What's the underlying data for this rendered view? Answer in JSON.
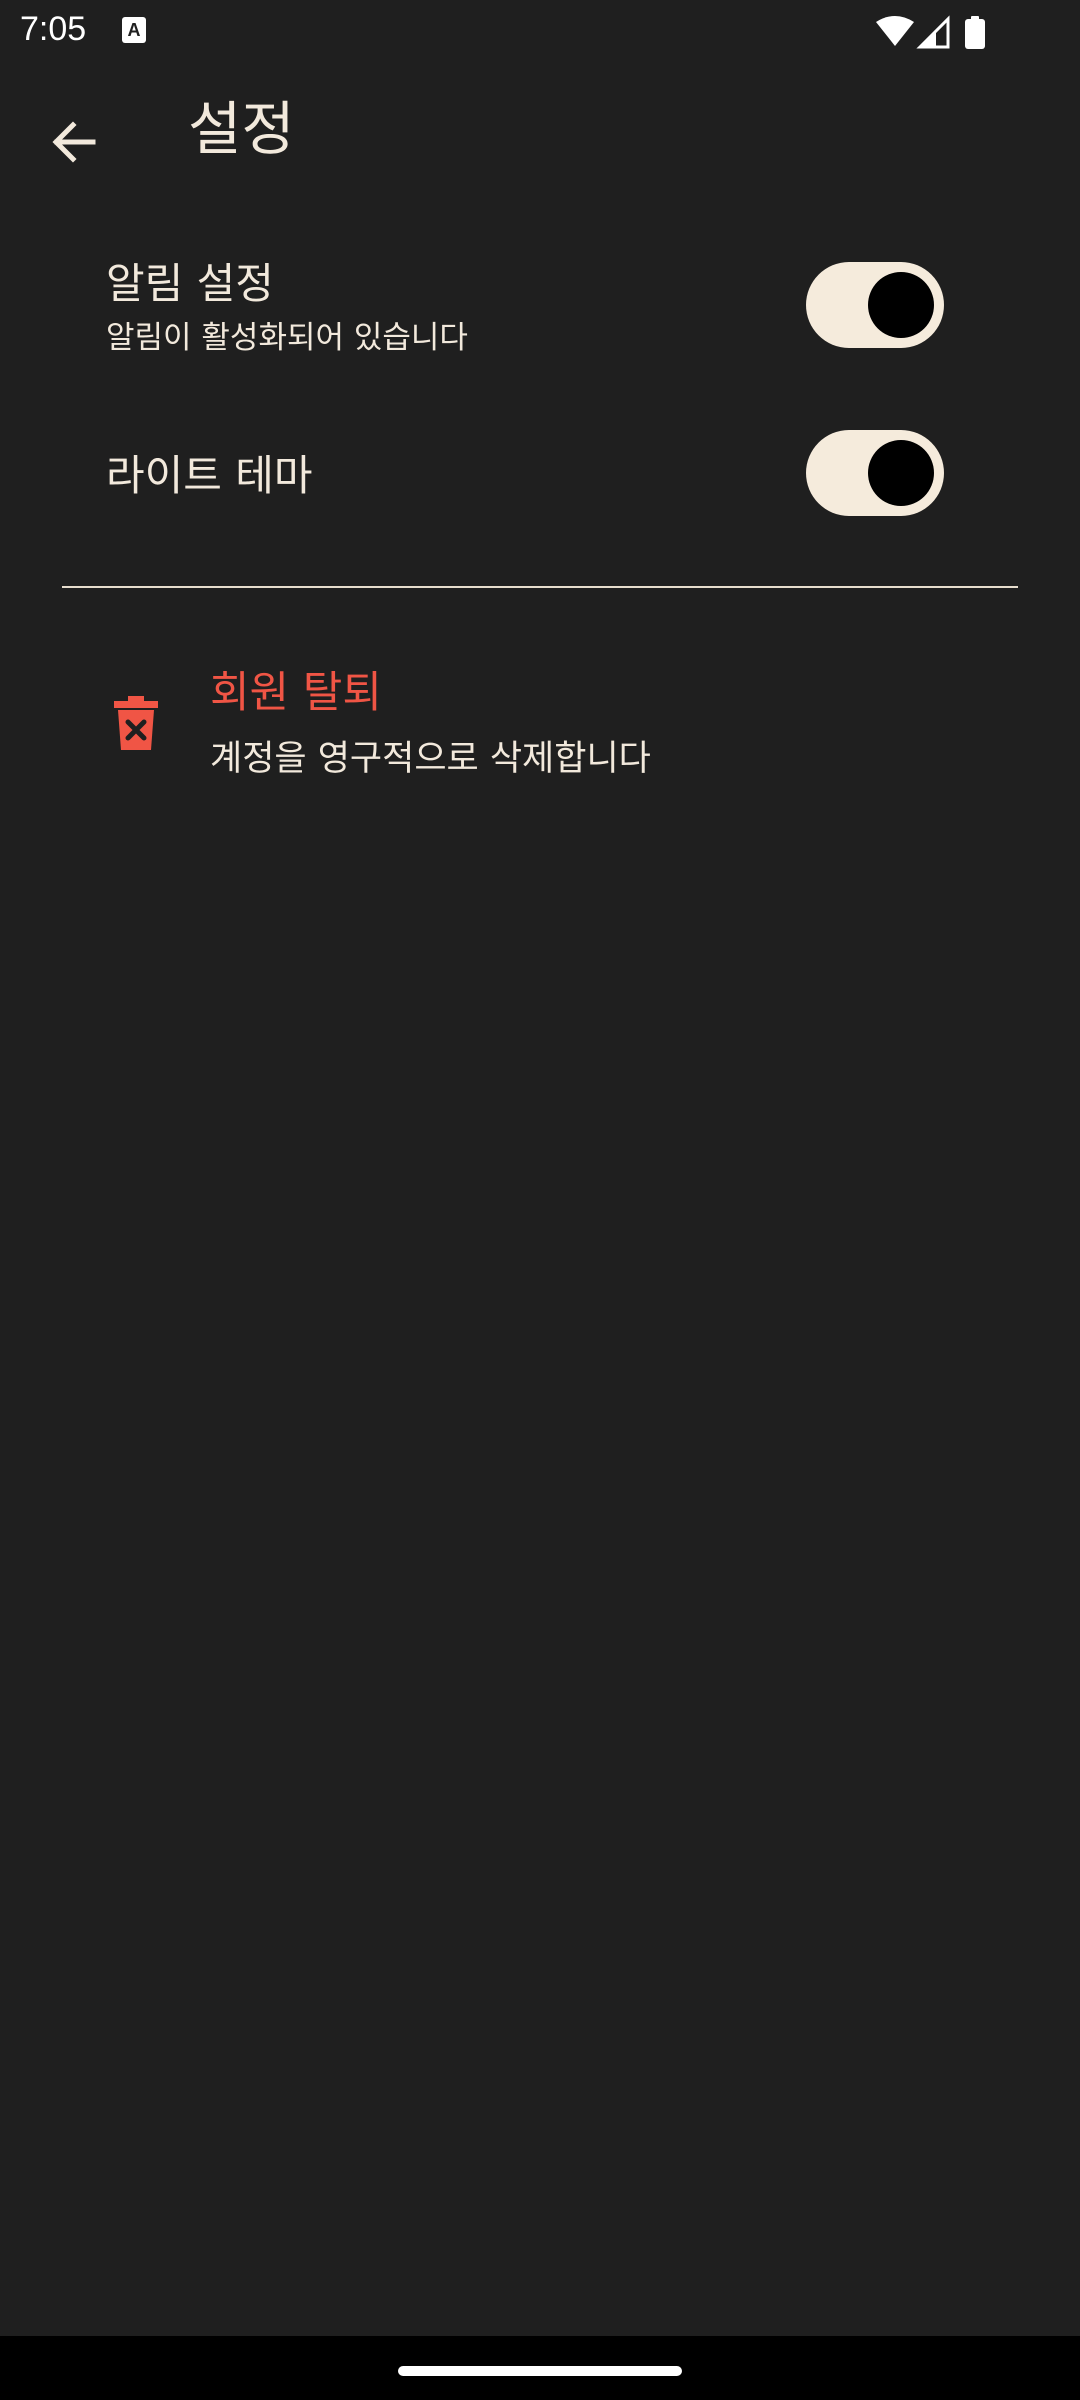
{
  "status_bar": {
    "time": "7:05",
    "keyboard_indicator": "A",
    "icons": [
      "wifi-icon",
      "signal-icon",
      "battery-icon"
    ]
  },
  "app_bar": {
    "title": "설정",
    "back_icon": "arrow-left-icon"
  },
  "settings": {
    "notifications": {
      "title": "알림 설정",
      "subtitle": "알림이 활성화되어 있습니다",
      "enabled": true
    },
    "light_theme": {
      "title": "라이트 테마",
      "enabled": true
    }
  },
  "delete_account": {
    "icon": "trash-x-icon",
    "title": "회원 탈퇴",
    "subtitle": "계정을 영구적으로 삭제합니다"
  },
  "colors": {
    "background": "#1f1f1f",
    "text": "#f2e9dc",
    "danger": "#f05545",
    "toggle_track": "#f5ebdc",
    "toggle_thumb": "#000000"
  }
}
